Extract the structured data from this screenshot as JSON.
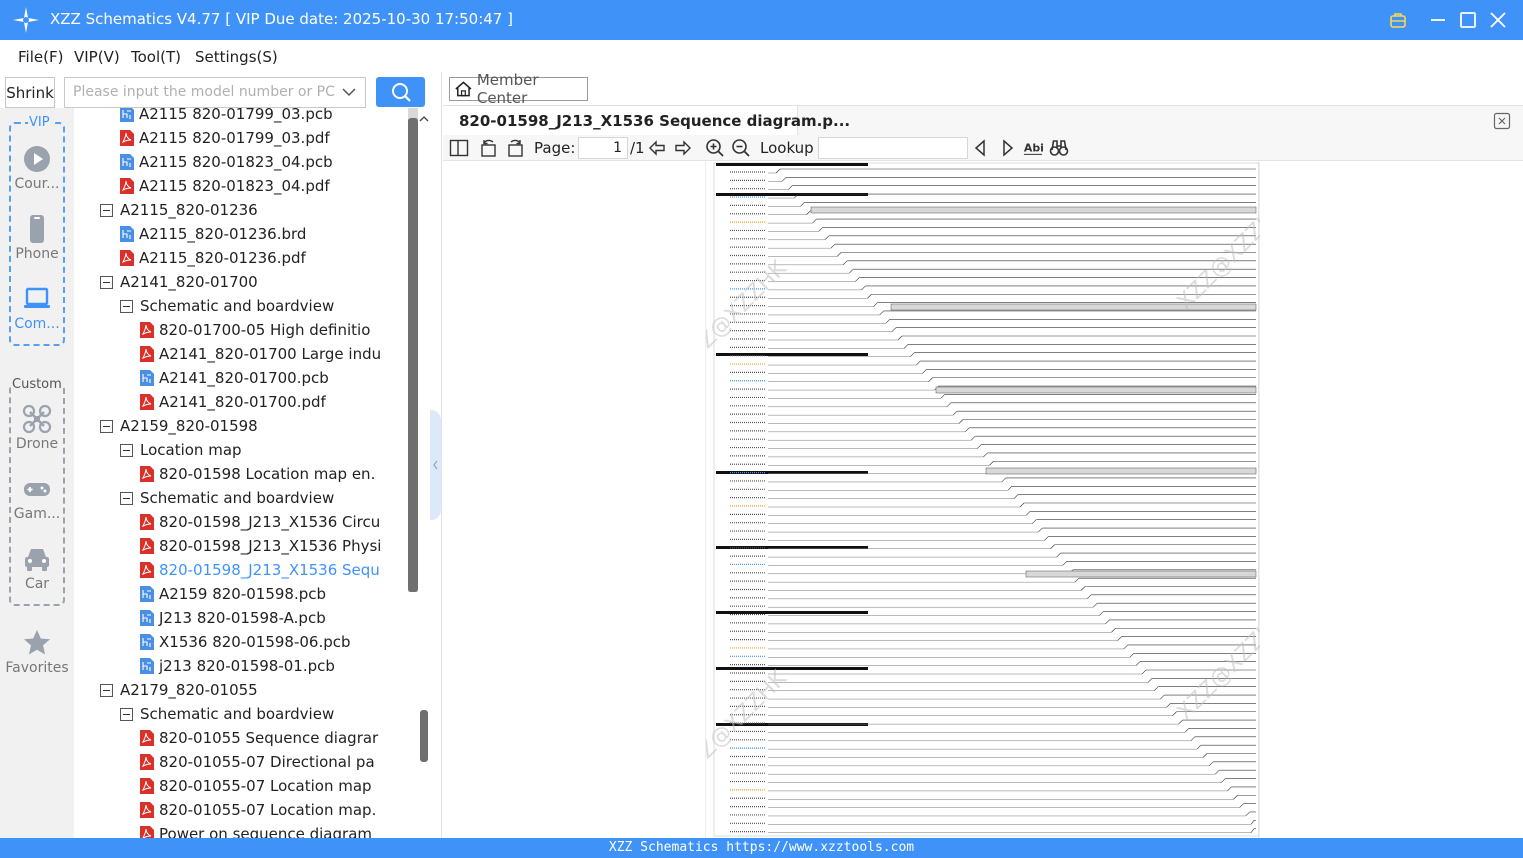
{
  "window": {
    "title": "XZZ Schematics V4.77 [ VIP Due date: 2025-10-30 17:50:47 ]"
  },
  "menu": {
    "items": [
      "File(F)",
      "VIP(V)",
      "Tool(T)",
      "Settings(S)"
    ]
  },
  "search": {
    "shrink_label": "Shrink",
    "placeholder": "Please input the model number or PCB"
  },
  "categories": {
    "vip_label": "VIP",
    "custom_label": "Custom",
    "vip_items": [
      {
        "label": "Cour...",
        "icon": "play-icon"
      },
      {
        "label": "Phone",
        "icon": "phone-icon"
      },
      {
        "label": "Com...",
        "icon": "laptop-icon"
      }
    ],
    "custom_items": [
      {
        "label": "Drone",
        "icon": "drone-icon"
      },
      {
        "label": "Gam...",
        "icon": "gamepad-icon"
      },
      {
        "label": "Car",
        "icon": "car-icon"
      }
    ],
    "favorites_label": "Favorites"
  },
  "tree": {
    "rows": [
      {
        "label": "A2115 820-01799_03.pcb",
        "type": "pcb"
      },
      {
        "label": "A2115 820-01799_03.pdf",
        "type": "pdf"
      },
      {
        "label": "A2115 820-01823_04.pcb",
        "type": "pcb"
      },
      {
        "label": "A2115 820-01823_04.pdf",
        "type": "pdf"
      },
      {
        "label": "A2115_820-01236",
        "type": "folder"
      },
      {
        "label": "A2115_820-01236.brd",
        "type": "pcb"
      },
      {
        "label": "A2115_820-01236.pdf",
        "type": "pdf"
      },
      {
        "label": "A2141_820-01700",
        "type": "folder"
      },
      {
        "label": "Schematic and boardview",
        "type": "folder"
      },
      {
        "label": "820-01700-05 High definitio",
        "type": "pdf"
      },
      {
        "label": "A2141_820-01700 Large indu",
        "type": "pdf"
      },
      {
        "label": "A2141_820-01700.pcb",
        "type": "pcb"
      },
      {
        "label": "A2141_820-01700.pdf",
        "type": "pdf"
      },
      {
        "label": "A2159_820-01598",
        "type": "folder"
      },
      {
        "label": "Location map",
        "type": "folder"
      },
      {
        "label": "820-01598 Location map en.",
        "type": "pdf"
      },
      {
        "label": "Schematic and boardview",
        "type": "folder"
      },
      {
        "label": "820-01598_J213_X1536 Circu",
        "type": "pdf"
      },
      {
        "label": "820-01598_J213_X1536 Physi",
        "type": "pdf"
      },
      {
        "label": "820-01598_J213_X1536 Sequ",
        "type": "pdf",
        "selected": true
      },
      {
        "label": "A2159 820-01598.pcb",
        "type": "pcb"
      },
      {
        "label": "J213 820-01598-A.pcb",
        "type": "pcb"
      },
      {
        "label": "X1536 820-01598-06.pcb",
        "type": "pcb"
      },
      {
        "label": "j213 820-01598-01.pcb",
        "type": "pcb"
      },
      {
        "label": "A2179_820-01055",
        "type": "folder"
      },
      {
        "label": "Schematic and boardview",
        "type": "folder"
      },
      {
        "label": "820-01055 Sequence diagrar",
        "type": "pdf"
      },
      {
        "label": "820-01055-07 Directional pa",
        "type": "pdf"
      },
      {
        "label": "820-01055-07 Location map",
        "type": "pdf"
      },
      {
        "label": "820-01055-07 Location map.",
        "type": "pdf"
      },
      {
        "label": "Power on sequence diagram",
        "type": "pdf"
      }
    ]
  },
  "viewer": {
    "member_center": "Member Center",
    "tab_title": "820-01598_J213_X1536 Sequence diagram.p...",
    "page_label": "Page:",
    "page_current": "1",
    "page_total": "/1",
    "lookup_label": "Lookup",
    "watermark": "XZZ@XZZHK"
  },
  "footer": {
    "text": "XZZ Schematics https://www.xzztools.com"
  },
  "colors": {
    "accent": "#3f93f8",
    "pdf_red": "#d9302a",
    "pcb_blue": "#4a8fe6"
  }
}
